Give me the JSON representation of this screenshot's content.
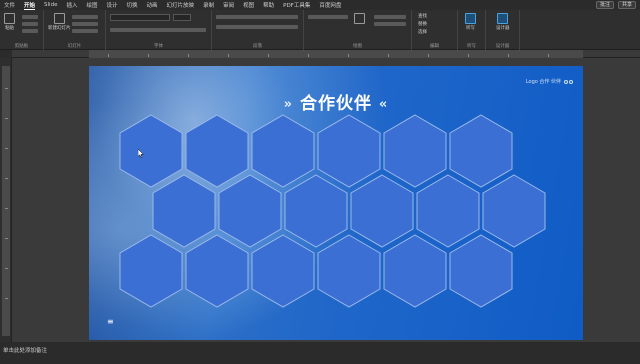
{
  "tabs": [
    "文件",
    "开始",
    "Slide",
    "插入",
    "绘图",
    "设计",
    "切换",
    "动画",
    "幻灯片放映",
    "录制",
    "审阅",
    "视图",
    "帮助",
    "PDF工具集",
    "百度网盘"
  ],
  "active_tab_index": 1,
  "share": {
    "comments_label": "批注",
    "share_label": "共享"
  },
  "ribbon": {
    "groups": [
      {
        "label": "剪贴板"
      },
      {
        "label": "幻灯片"
      },
      {
        "label": "字体"
      },
      {
        "label": "段落"
      },
      {
        "label": "绘图"
      },
      {
        "label": "编辑"
      },
      {
        "label": "听写"
      },
      {
        "label": "设计器"
      }
    ],
    "buttons": {
      "paste": "粘贴",
      "new_slide": "新建幻灯片",
      "dictate": "听写",
      "designer": "设计器",
      "find": "查找",
      "replace": "替换",
      "select": "选择"
    }
  },
  "slide": {
    "title": "合作伙伴",
    "chevron_left": "»",
    "chevron_right": "«",
    "topright_text": "Logo 合作 伙伴",
    "menu_glyph": "≡",
    "hex_fill": "#3b6fd4",
    "hex_stroke": "#9bb9ea"
  },
  "status": {
    "notes": "单击此处添加备注"
  }
}
